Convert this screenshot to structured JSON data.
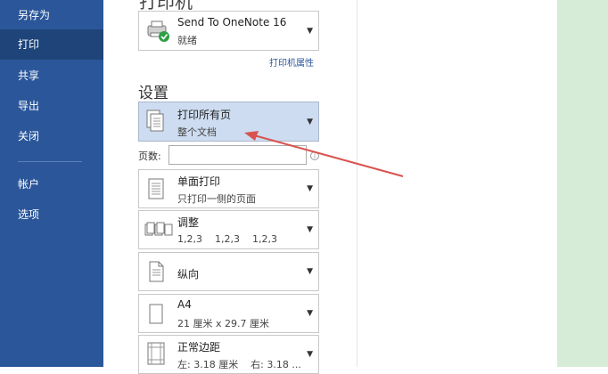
{
  "sidebar": {
    "items": [
      {
        "label": "另存为"
      },
      {
        "label": "打印"
      },
      {
        "label": "共享"
      },
      {
        "label": "导出"
      },
      {
        "label": "关闭"
      },
      {
        "label": "帐户"
      },
      {
        "label": "选项"
      }
    ]
  },
  "printer": {
    "section_title": "打印机",
    "name": "Send To OneNote 16",
    "status": "就绪",
    "properties_link": "打印机属性"
  },
  "settings": {
    "section_title": "设置",
    "print_range": {
      "title": "打印所有页",
      "subtitle": "整个文档"
    },
    "pages_label": "页数:",
    "pages_value": "",
    "sides": {
      "title": "单面打印",
      "subtitle": "只打印一侧的页面"
    },
    "collate": {
      "title": "调整",
      "subtitle": "1,2,3    1,2,3    1,2,3"
    },
    "orientation": {
      "title": "纵向"
    },
    "paper": {
      "title": "A4",
      "subtitle": "21 厘米 x 29.7 厘米"
    },
    "margins": {
      "title": "正常边距",
      "subtitle": "左: 3.18 厘米    右: 3.18 ..."
    }
  },
  "colors": {
    "sidebar_bg": "#2b579a",
    "sidebar_active": "#1e4479",
    "highlight": "#cddcf0",
    "annotation_arrow": "#d9534f",
    "preview_green": "#d6ecd6"
  }
}
